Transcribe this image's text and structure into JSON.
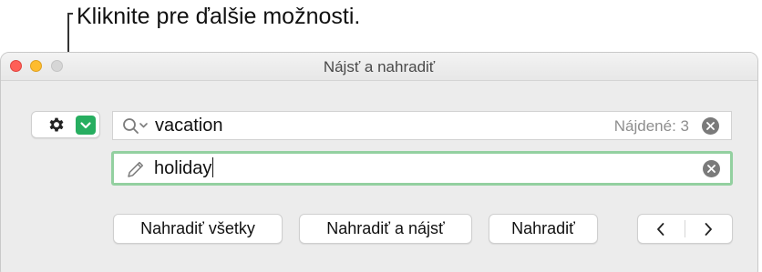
{
  "callout": {
    "text": "Kliknite pre ďalšie možnosti."
  },
  "window": {
    "title": "Nájsť a nahradiť"
  },
  "find": {
    "value": "vacation",
    "found_count": "Nájdené: 3"
  },
  "replace": {
    "value": "holiday"
  },
  "buttons": {
    "replace_all": "Nahradiť všetky",
    "replace_and_find": "Nahradiť a nájsť",
    "replace": "Nahradiť"
  },
  "colors": {
    "accent_green": "#27ae60",
    "focus_ring": "#93d0a0",
    "close": "#ff5f57",
    "minimize": "#febc2e"
  },
  "icons": [
    "gear-icon",
    "chevron-down-icon",
    "search-icon",
    "clear-icon",
    "pencil-icon",
    "chevron-left-icon",
    "chevron-right-icon"
  ]
}
